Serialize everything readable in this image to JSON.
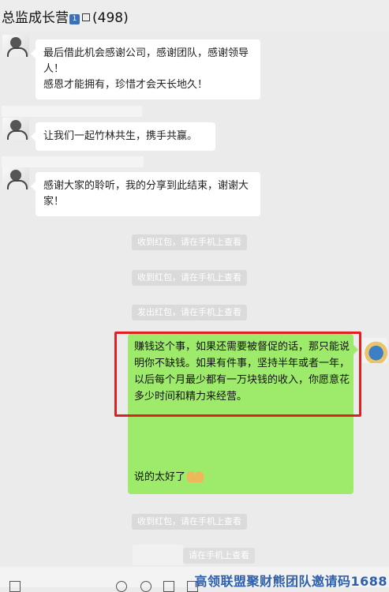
{
  "header": {
    "title": "总监成长营",
    "badge": "1",
    "member_count": "(498)"
  },
  "messages": [
    {
      "text": "最后借此机会感谢公司，感谢团队，感谢领导人！\n感恩才能拥有，珍惜才会天长地久！"
    },
    {
      "text": "让我们一起竹林共生，携手共赢。"
    },
    {
      "text": "感谢大家的聆听，我的分享到此结束，谢谢大家！"
    }
  ],
  "system_notices": [
    "收到红包，请在手机上查看",
    "收到红包，请在手机上查看",
    "发出红包，请在手机上查看",
    "收到红包，请在手机上查看",
    "请在手机上查看"
  ],
  "self_message": {
    "text": "赚钱这个事，如果还需要被督促的话，那只能说明你不缺钱。如果有件事，坚持半年或者一年，以后每个月最少都有一万块钱的收入，你愿意花多少时间和精力来经营。",
    "reply": "说的太好了"
  },
  "watermark": "高领联盟聚财熊团队邀请码1688",
  "colors": {
    "self_bubble": "#9eea6a",
    "highlight_border": "#e02020",
    "background": "#ebebeb"
  }
}
